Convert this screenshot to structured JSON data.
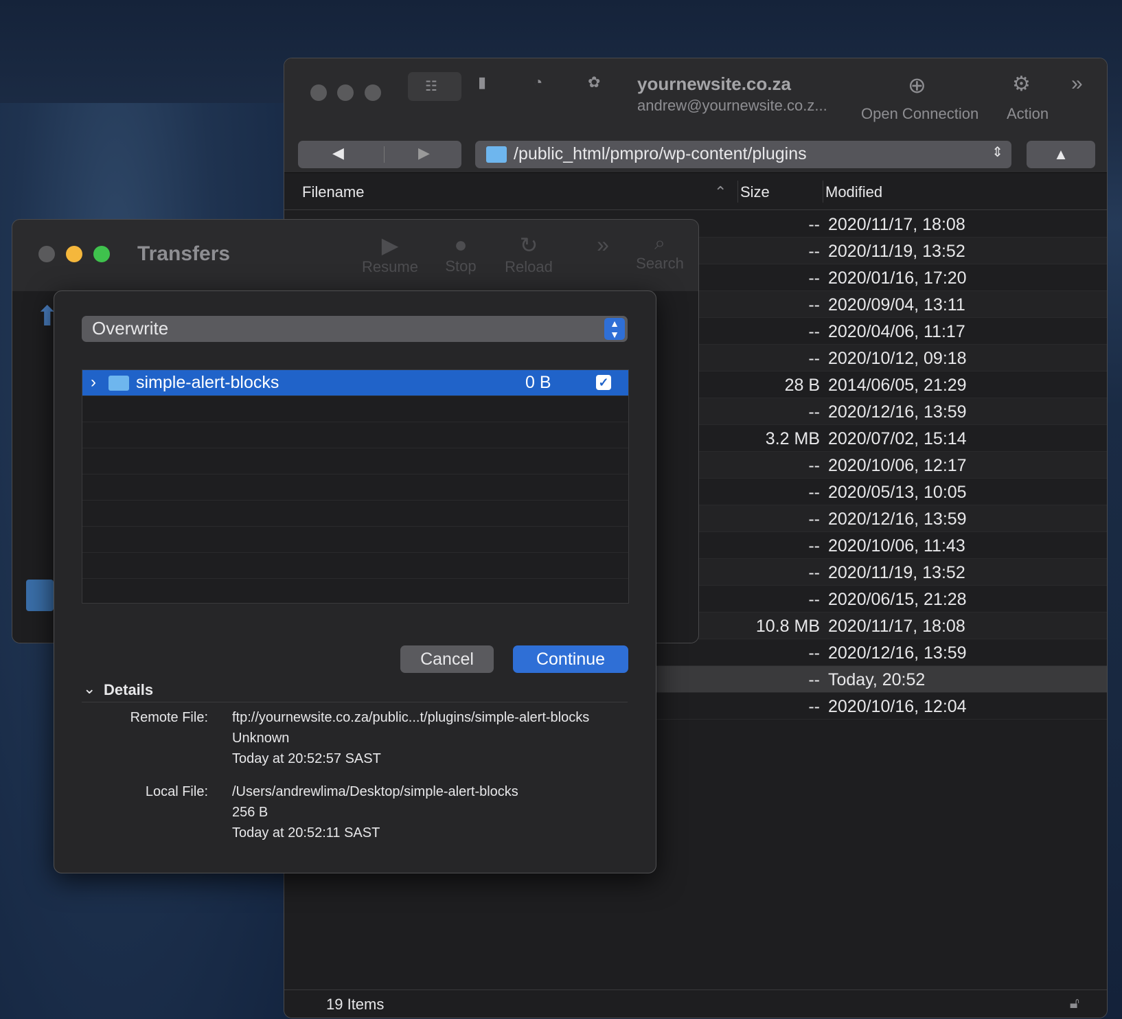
{
  "main_window": {
    "site_title": "yournewsite.co.za",
    "site_user": "andrew@yournewsite.co.z...",
    "toolbar": {
      "open_connection_label": "Open Connection",
      "action_label": "Action"
    },
    "path": "/public_html/pmpro/wp-content/plugins",
    "columns": {
      "filename": "Filename",
      "size": "Size",
      "modified": "Modified"
    },
    "rows": [
      {
        "size": "--",
        "modified": "2020/11/17, 18:08"
      },
      {
        "size": "--",
        "modified": "2020/11/19, 13:52"
      },
      {
        "size": "--",
        "modified": "2020/01/16, 17:20"
      },
      {
        "size": "--",
        "modified": "2020/09/04, 13:11"
      },
      {
        "size": "--",
        "modified": "2020/04/06, 11:17"
      },
      {
        "size": "--",
        "modified": "2020/10/12, 09:18"
      },
      {
        "size": "28 B",
        "modified": "2014/06/05, 21:29"
      },
      {
        "size": "--",
        "modified": "2020/12/16, 13:59"
      },
      {
        "size": "3.2 MB",
        "modified": "2020/07/02, 15:14"
      },
      {
        "size": "--",
        "modified": "2020/10/06, 12:17"
      },
      {
        "size": "--",
        "modified": "2020/05/13, 10:05"
      },
      {
        "size": "--",
        "modified": "2020/12/16, 13:59"
      },
      {
        "size": "--",
        "modified": "2020/10/06, 11:43"
      },
      {
        "size": "--",
        "modified": "2020/11/19, 13:52"
      },
      {
        "size": "--",
        "modified": "2020/06/15, 21:28"
      },
      {
        "size": "10.8 MB",
        "modified": "2020/11/17, 18:08"
      },
      {
        "size": "--",
        "modified": "2020/12/16, 13:59"
      },
      {
        "size": "--",
        "modified": "Today, 20:52"
      },
      {
        "size": "--",
        "modified": "2020/10/16, 12:04"
      }
    ],
    "status": "19 Items"
  },
  "transfers_window": {
    "title": "Transfers",
    "tools": {
      "resume": "Resume",
      "stop": "Stop",
      "reload": "Reload",
      "search": "Search"
    }
  },
  "dialog": {
    "mode": "Overwrite",
    "item": {
      "name": "simple-alert-blocks",
      "size": "0 B",
      "checked": true
    },
    "cancel_label": "Cancel",
    "continue_label": "Continue",
    "details_label": "Details",
    "remote_label": "Remote File:",
    "remote_path": "ftp://yournewsite.co.za/public...t/plugins/simple-alert-blocks",
    "remote_size": "Unknown",
    "remote_date": "Today at 20:52:57 SAST",
    "local_label": "Local File:",
    "local_path": "/Users/andrewlima/Desktop/simple-alert-blocks",
    "local_size": "256 B",
    "local_date": "Today at 20:52:11 SAST"
  },
  "colors": {
    "accent": "#2f6fd6",
    "selection": "#2063c9"
  }
}
